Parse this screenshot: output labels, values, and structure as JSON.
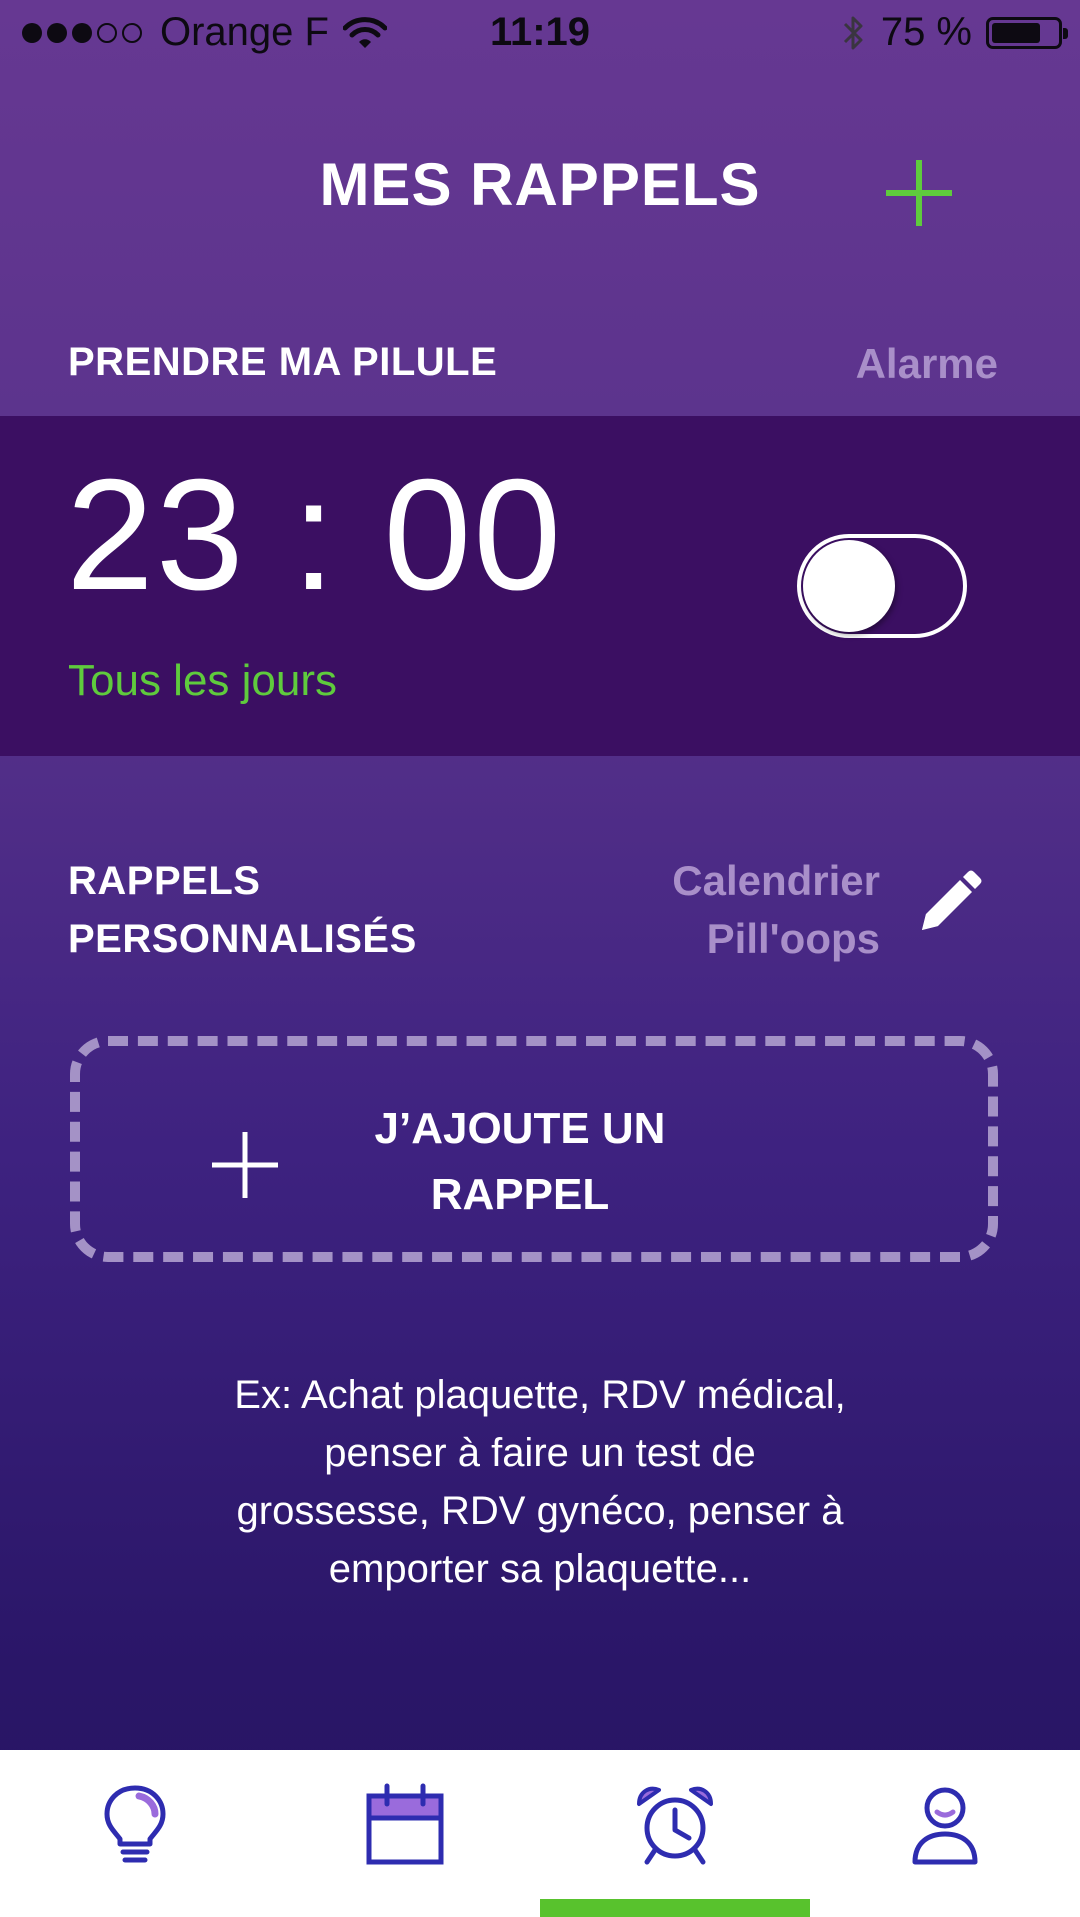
{
  "status_bar": {
    "carrier": "Orange F",
    "time": "11:19",
    "battery": "75 %",
    "battery_level_percent": 75,
    "signal_bars_filled": 3,
    "signal_bars_total": 5
  },
  "header": {
    "title": "MES RAPPELS"
  },
  "pill_section": {
    "title": "PRENDRE MA PILULE",
    "alarm_label": "Alarme",
    "alarm_time": "23 : 00",
    "repeat": "Tous les jours",
    "toggle_on": false
  },
  "custom_section": {
    "title_line1": "RAPPELS",
    "title_line2": "PERSONNALISÉS",
    "calendar_line1": "Calendrier",
    "calendar_line2": "Pill'oops",
    "add_line1": "J’AJOUTE UN",
    "add_line2": "RAPPEL",
    "examples_line1": "Ex: Achat plaquette, RDV médical,",
    "examples_line2": "penser à faire un test de",
    "examples_line3": "grossesse, RDV gynéco, penser à",
    "examples_line4": "emporter sa plaquette..."
  },
  "tabbar": {
    "tabs": [
      {
        "icon": "lightbulb-icon"
      },
      {
        "icon": "calendar-icon"
      },
      {
        "icon": "alarm-clock-icon",
        "active": true
      },
      {
        "icon": "profile-icon"
      }
    ]
  },
  "colors": {
    "accent_green": "#5fcb3d",
    "panel_dark": "#3b0f62",
    "muted_lilac": "#a98fc9",
    "icon_blue": "#2e2cb0",
    "icon_purple": "#9a6bdc"
  }
}
